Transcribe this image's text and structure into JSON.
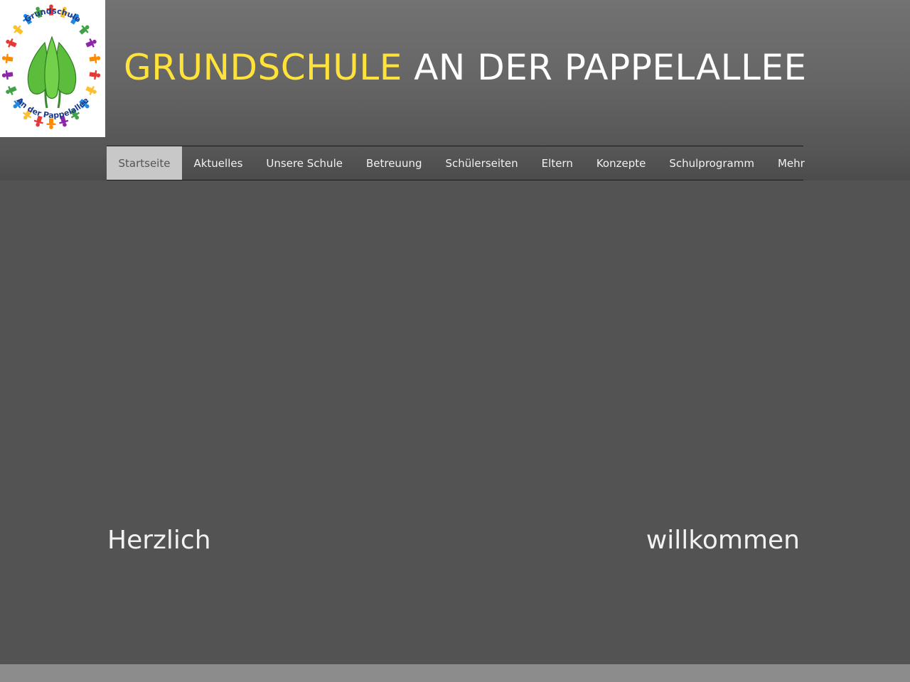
{
  "logo": {
    "text_top": "Grundschule",
    "text_bottom": "An der Pappelallee"
  },
  "header": {
    "title_part1": "GRUNDSCHULE",
    "title_part2": "AN DER PAPPELALLEE",
    "title_part1_color": "#ffe33a",
    "title_part2_color": "#ffffff"
  },
  "nav": {
    "active_bg": "#c8c8c8",
    "items": [
      {
        "label": "Startseite",
        "active": true
      },
      {
        "label": "Aktuelles"
      },
      {
        "label": "Unsere Schule"
      },
      {
        "label": "Betreuung"
      },
      {
        "label": "Schülerseiten"
      },
      {
        "label": "Eltern"
      },
      {
        "label": "Konzepte"
      },
      {
        "label": "Schulprogramm"
      },
      {
        "label": "Mehr"
      }
    ]
  },
  "main": {
    "welcome_left": "Herzlich",
    "welcome_right": "willkommen"
  }
}
